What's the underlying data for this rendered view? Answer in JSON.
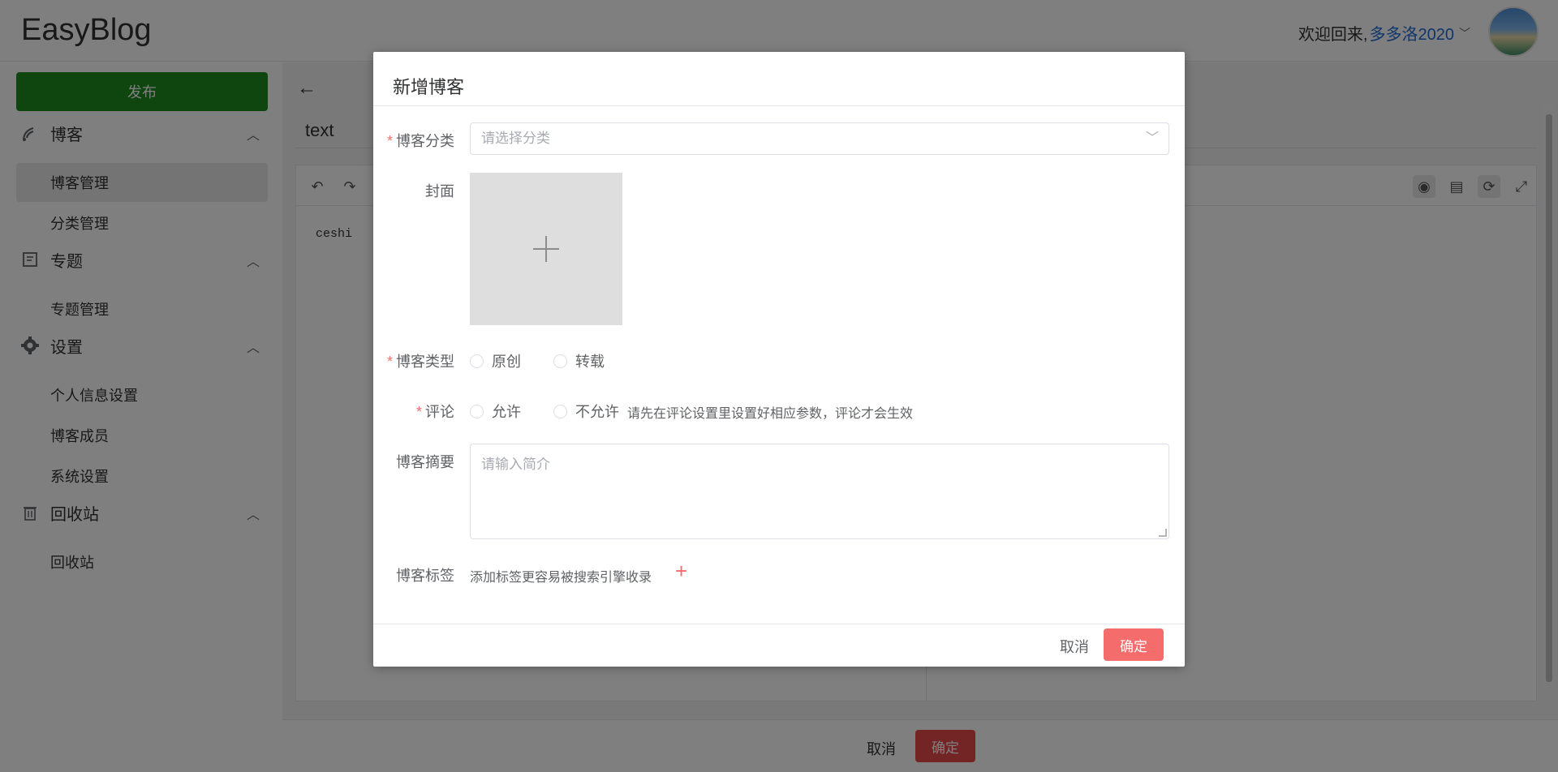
{
  "app": {
    "logo": "EasyBlog"
  },
  "header": {
    "welcome": "欢迎回来,",
    "username": "多多洛2020"
  },
  "sidebar": {
    "publish_label": "发布",
    "groups": [
      {
        "label": "博客",
        "icon": "blog-icon",
        "items": [
          "博客管理",
          "分类管理"
        ]
      },
      {
        "label": "专题",
        "icon": "topic-icon",
        "items": [
          "专题管理"
        ]
      },
      {
        "label": "设置",
        "icon": "gear-icon",
        "items": [
          "个人信息设置",
          "博客成员",
          "系统设置"
        ]
      },
      {
        "label": "回收站",
        "icon": "trash-icon",
        "items": [
          "回收站"
        ]
      }
    ],
    "active_item": "博客管理"
  },
  "editor": {
    "title_value": "text",
    "content": "ceshi",
    "bottom_cancel": "取消",
    "bottom_ok": "确定"
  },
  "dialog": {
    "title": "新增博客",
    "category_label": "博客分类",
    "category_placeholder": "请选择分类",
    "cover_label": "封面",
    "type_label": "博客类型",
    "type_options": [
      "原创",
      "转载"
    ],
    "comment_label": "评论",
    "comment_options": [
      "允许",
      "不允许"
    ],
    "comment_hint": "请先在评论设置里设置好相应参数，评论才会生效",
    "summary_label": "博客摘要",
    "summary_placeholder": "请输入简介",
    "tags_label": "博客标签",
    "tags_hint": "添加标签更容易被搜索引擎收录",
    "cancel": "取消",
    "ok": "确定"
  },
  "colors": {
    "publish": "#1f8a1f",
    "accent": "#f56c6c",
    "link": "#1e6bd6"
  }
}
